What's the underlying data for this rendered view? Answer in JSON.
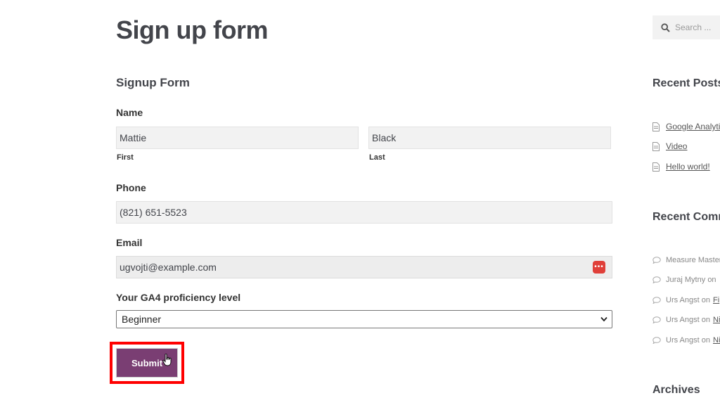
{
  "page": {
    "title": "Sign up form",
    "form_title": "Signup Form"
  },
  "form": {
    "name_label": "Name",
    "first_value": "Mattie",
    "first_sublabel": "First",
    "last_value": "Black",
    "last_sublabel": "Last",
    "phone_label": "Phone",
    "phone_value": "(821) 651-5523",
    "email_label": "Email",
    "email_value": "ugvojti@example.com",
    "proficiency_label": "Your GA4 proficiency level",
    "proficiency_value": "Beginner",
    "submit_label": "Submit"
  },
  "sidebar": {
    "search_placeholder": "Search ...",
    "recent_posts_heading": "Recent Posts",
    "recent_posts": [
      "Google Analyti",
      "Video",
      "Hello world!"
    ],
    "recent_comments_heading": "Recent Comm",
    "recent_comments": [
      {
        "author": "Measure Master",
        "suffix": "",
        "link": ""
      },
      {
        "author": "Juraj Mytny",
        "suffix": "on",
        "link": ""
      },
      {
        "author": "Urs Angst",
        "suffix": "on",
        "link": "Fi"
      },
      {
        "author": "Urs Angst",
        "suffix": "on",
        "link": "Ni"
      },
      {
        "author": "Urs Angst",
        "suffix": "on",
        "link": "Ni"
      }
    ],
    "archives_heading": "Archives"
  },
  "colors": {
    "submit_bg": "#7a3e73",
    "highlight": "#ff0000",
    "password_icon": "#e0403a"
  }
}
